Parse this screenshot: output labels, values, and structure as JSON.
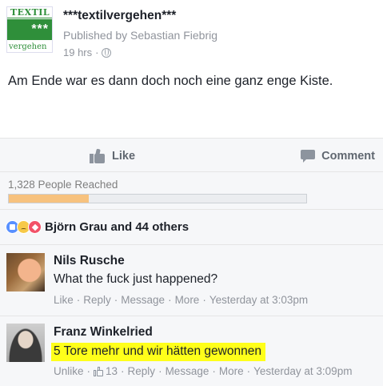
{
  "post": {
    "logo": {
      "top": "TEXTIL",
      "stars": "***",
      "bottom": "vergehen"
    },
    "page_name": "***textilvergehen***",
    "published_by": "Published by Sebastian Fiebrig",
    "time": "19 hrs",
    "time_sep": "·",
    "text": "Am Ende war es dann doch noch eine ganz enge Kiste."
  },
  "actions": {
    "like_label": "Like",
    "comment_label": "Comment"
  },
  "reach": {
    "text": "1,328 People Reached",
    "progress": 0.27
  },
  "reactions": {
    "names": "Björn Grau and 44 others",
    "types": [
      "like",
      "sad",
      "love"
    ]
  },
  "comments": [
    {
      "author": "Nils Rusche",
      "text": "What the fuck just happened?",
      "actions": [
        "Like",
        "Reply",
        "Message",
        "More"
      ],
      "timestamp": "Yesterday at 3:03pm"
    },
    {
      "author": "Franz Winkelried",
      "text": "5 Tore mehr und wir hätten gewonnen",
      "actions": [
        "Unlike",
        "Reply",
        "Message",
        "More"
      ],
      "like_count": "13",
      "timestamp": "Yesterday at 3:09pm"
    }
  ],
  "separator": "·",
  "colors": {
    "highlight": "#ffff1a",
    "reach_fill": "#f7c27e",
    "logo_green": "#2f8f3a"
  }
}
